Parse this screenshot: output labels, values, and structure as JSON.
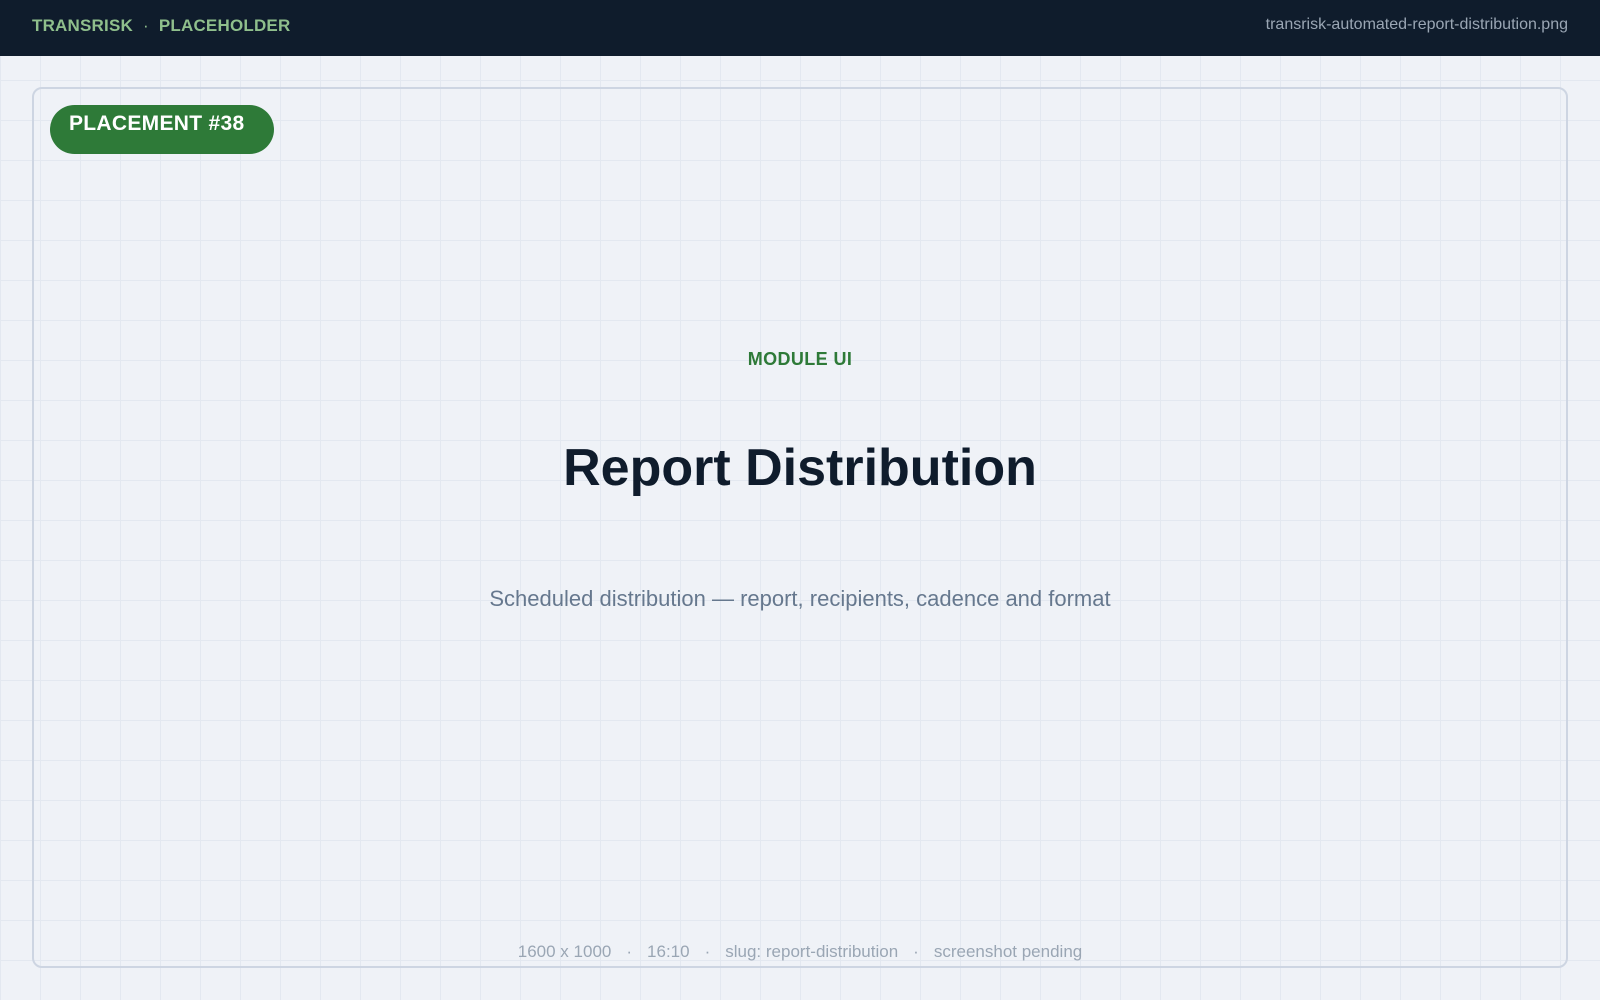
{
  "header": {
    "brand": "TRANSRISK",
    "separator": "·",
    "section": "PLACEHOLDER",
    "filename": "transrisk-automated-report-distribution.png"
  },
  "badge": {
    "label": "PLACEMENT #38"
  },
  "main": {
    "eyebrow": "MODULE UI",
    "title": "Report Distribution",
    "subtitle": "Scheduled distribution — report, recipients, cadence and format"
  },
  "footer": {
    "separator": "·",
    "items": [
      "1600 x 1000",
      "16:10",
      "slug: report-distribution",
      "screenshot pending"
    ]
  },
  "colors": {
    "topbar": "#0f1c2c",
    "accent_green": "#2e7a38",
    "brand_text": "#8fbf8c",
    "muted_text": "#9aa6b4",
    "background": "#eff2f7"
  }
}
